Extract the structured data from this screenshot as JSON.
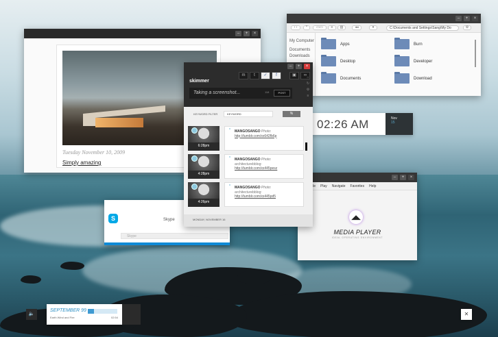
{
  "blog": {
    "date": "Tuesday November 10, 2009",
    "post_title": "Simply amazing",
    "btn_min": "–",
    "btn_max": "+",
    "btn_close": "×"
  },
  "explorer": {
    "btn_min": "–",
    "btn_max": "+",
    "btn_close": "×",
    "address": "C:\\Documents and Settings\\Sang\\My Do",
    "sidebar": [
      "My Computer",
      "Documents",
      "Downloads"
    ],
    "folders": [
      "Apps",
      "Burn",
      "Desktop",
      "Developer",
      "Documents",
      "Download"
    ]
  },
  "clock": {
    "time": "02:26 AM",
    "month": "Nov",
    "day": "15"
  },
  "skimmer": {
    "btn_min": "–",
    "btn_max": "+",
    "btn_close": "×",
    "logo": "skimmer",
    "status_text": "Taking a screenshot...",
    "char_count": "118",
    "post_label": "POST",
    "filter_label": "KEYWORD FILTER",
    "keyword_placeholder": "KEYWORD",
    "percent_label": "%",
    "day_header": "MONDAY, NOVEMBER 16",
    "entries": [
      {
        "time": "6:28",
        "ampm": "pm",
        "user": "MANGOSANGO",
        "kind": "Photo",
        "link": "http://tumblr.com/xx642fb6p"
      },
      {
        "time": "4:28",
        "ampm": "pm",
        "user": "MANGOSANGO",
        "kind": "Photo",
        "source": "architecturebblog",
        "link": "http://tumblr.com/xx445pesz"
      },
      {
        "time": "4:26",
        "ampm": "pm",
        "user": "MANGOSANGO",
        "kind": "Photo",
        "source": "architecturebblog",
        "link": "http://tumblr.com/xx445pd5"
      }
    ]
  },
  "skype": {
    "title": "Skype",
    "search_placeholder": "Skype",
    "logo": "S"
  },
  "media": {
    "btn_min": "–",
    "btn_max": "+",
    "btn_close": "×",
    "menu": [
      "File",
      "Play",
      "Navigate",
      "Favorites",
      "Help"
    ],
    "title": "MEDIA PLAYER",
    "subtitle": "IDEAL OPERATING ENVIRONMENT"
  },
  "music": {
    "song": "SEPTEMBER 99",
    "artist": "Earth Wind and Fire",
    "duration": "02:54",
    "progress_fraction": 0.2
  },
  "taskbar": {
    "volume_icon": "🔈",
    "close_icon": "✕"
  },
  "colors": {
    "accent": "#3e9ad2",
    "skimmer_dark": "#2c2c2c",
    "skype_blue": "#0f8ad6"
  }
}
